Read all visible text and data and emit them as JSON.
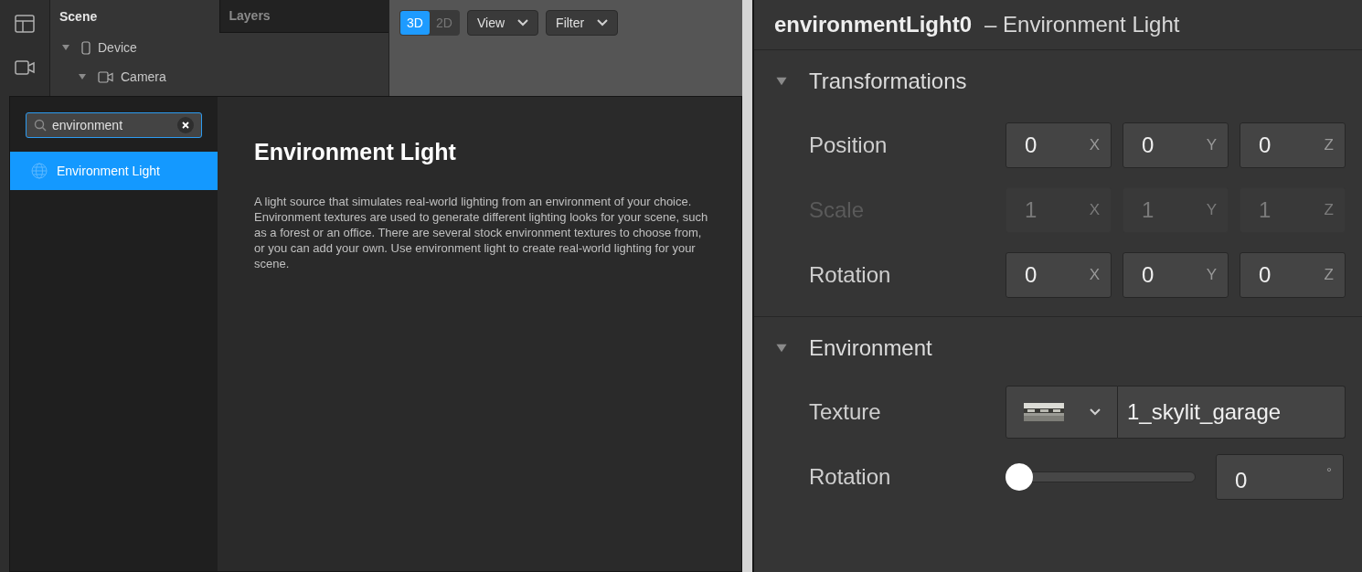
{
  "rail": [
    {
      "kind": "layout"
    },
    {
      "kind": "camera"
    }
  ],
  "scene_panel": {
    "tabs": [
      {
        "label": "Scene",
        "selected": true
      },
      {
        "label": "Layers",
        "selected": false
      }
    ],
    "tree": [
      {
        "label": "Device",
        "kind": "device",
        "expanded": true,
        "children": [
          {
            "label": "Camera",
            "kind": "camera",
            "expanded": true
          }
        ]
      }
    ]
  },
  "viewport_toolbar": {
    "modes": [
      {
        "label": "3D",
        "selected": true
      },
      {
        "label": "2D",
        "selected": false
      }
    ],
    "dropdowns": [
      "View",
      "Filter"
    ]
  },
  "add_popup": {
    "search": {
      "value": "environment"
    },
    "results": [
      {
        "label": "Environment Light",
        "selected": true
      }
    ],
    "detail": {
      "title": "Environment Light",
      "description": "A light source that simulates real-world lighting from an environment of your choice. Environment textures are used to generate different lighting looks for your scene, such as a forest or an office. There are several stock environment textures to choose from, or you can add your own. Use environment light to create real-world lighting for your scene."
    }
  },
  "inspector": {
    "name": "environmentLight0",
    "type": "– Environment Light",
    "sections": [
      {
        "title": "Transformations",
        "expanded": true,
        "rows": [
          {
            "kind": "vector",
            "label": "Position",
            "disabled": false,
            "fields": [
              {
                "value": "0",
                "axis": "X"
              },
              {
                "value": "0",
                "axis": "Y"
              },
              {
                "value": "0",
                "axis": "Z"
              }
            ]
          },
          {
            "kind": "vector",
            "label": "Scale",
            "disabled": true,
            "fields": [
              {
                "value": "1",
                "axis": "X"
              },
              {
                "value": "1",
                "axis": "Y"
              },
              {
                "value": "1",
                "axis": "Z"
              }
            ]
          },
          {
            "kind": "vector",
            "label": "Rotation",
            "disabled": false,
            "fields": [
              {
                "value": "0",
                "axis": "X"
              },
              {
                "value": "0",
                "axis": "Y"
              },
              {
                "value": "0",
                "axis": "Z"
              }
            ]
          }
        ]
      },
      {
        "title": "Environment",
        "expanded": true,
        "rows": [
          {
            "kind": "texture",
            "label": "Texture",
            "value": "1_skylit_garage"
          },
          {
            "kind": "slider",
            "label": "Rotation",
            "level": 0,
            "value": "0",
            "unit": "°"
          }
        ]
      }
    ]
  }
}
